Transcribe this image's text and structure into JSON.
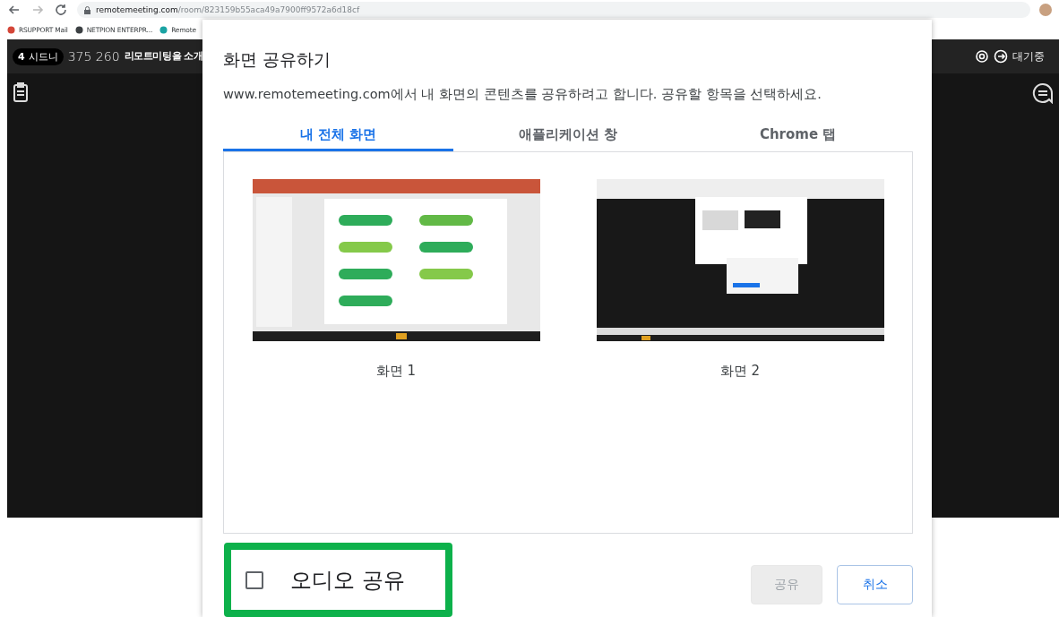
{
  "browser": {
    "url_host": "remotemeeting.com",
    "url_path": "/room/823159b55aca49a7900ff9572a6d18cf",
    "bookmarks": [
      "RSUPPORT Mail",
      "NETPION ENTERPR...",
      "Remote"
    ]
  },
  "app": {
    "participant_count": "4",
    "location": "시드니",
    "room_number": "375 260",
    "room_title": "리모트미팅을 소개",
    "status": "대기중"
  },
  "dialog": {
    "title": "화면 공유하기",
    "description": "www.remotemeeting.com에서 내 화면의 콘텐츠를 공유하려고 합니다. 공유할 항목을 선택하세요.",
    "tabs": [
      {
        "label": "내 전체 화면",
        "selected": true
      },
      {
        "label": "애플리케이션 창",
        "selected": false
      },
      {
        "label": "Chrome 탭",
        "selected": false
      }
    ],
    "sources": [
      {
        "label": "화면 1",
        "kind": "slides"
      },
      {
        "label": "화면 2",
        "kind": "desktop"
      }
    ],
    "audio_share": {
      "label": "오디오 공유",
      "checked": false
    },
    "buttons": [
      {
        "label": "공유",
        "disabled": true
      },
      {
        "label": "취소",
        "disabled": false
      }
    ]
  }
}
